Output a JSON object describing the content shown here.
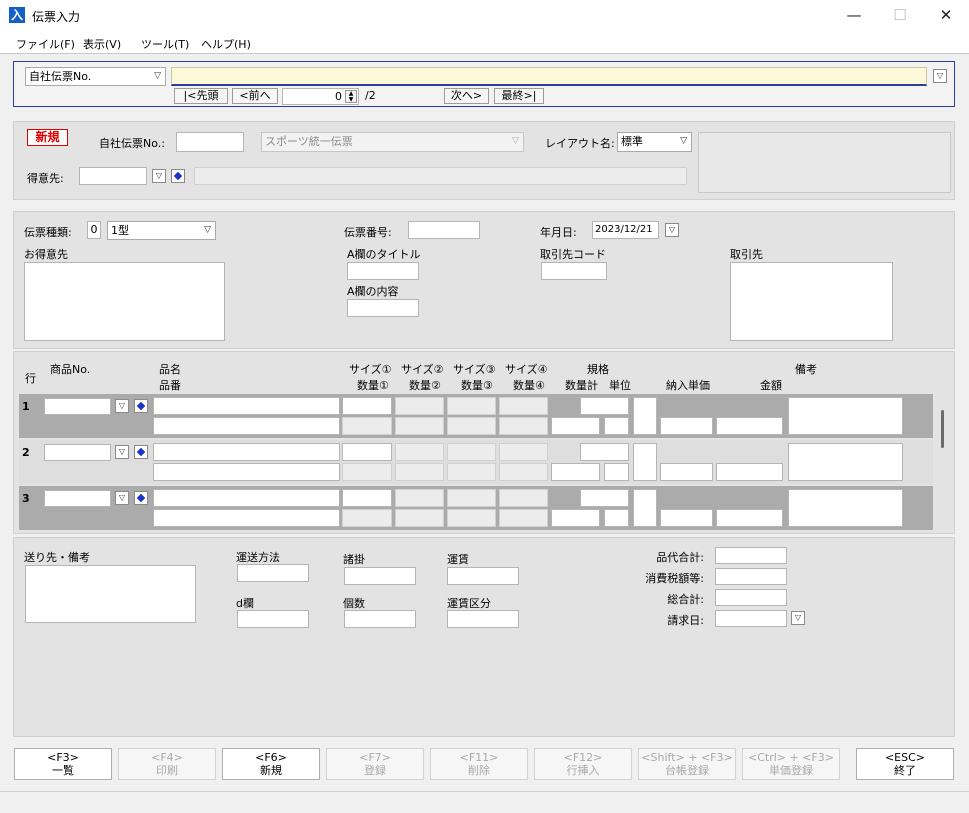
{
  "window": {
    "title": "伝票入力",
    "minimize": "—",
    "maximize": "☐",
    "close": "✕"
  },
  "menu": [
    {
      "label": "ファイル(F)"
    },
    {
      "label": "表示(V)"
    },
    {
      "label": "ツール(T)"
    },
    {
      "label": "ヘルプ(H)"
    }
  ],
  "search": {
    "type_select": "自社伝票No.",
    "first_btn": "|<先頭",
    "prev_btn": "<前へ",
    "page_value": "0",
    "page_total": "/2",
    "next_btn": "次へ>",
    "last_btn": "最終>|"
  },
  "header": {
    "new_badge": "新規",
    "slip_no_label": "自社伝票No.:",
    "slip_type_select": "スポーツ統一伝票",
    "layout_label": "レイアウト名:",
    "layout_value": "標準",
    "customer_label": "得意先:"
  },
  "slip": {
    "kind_label": "伝票種類:",
    "kind_code": "0",
    "kind_value": "1型",
    "number_label": "伝票番号:",
    "date_label": "年月日:",
    "date_value": "2023/12/21",
    "customer_box_label": "お得意先",
    "a_title_label": "A欄のタイトル",
    "a_content_label": "A欄の内容",
    "partner_code_label": "取引先コード",
    "partner_label": "取引先"
  },
  "grid": {
    "headers": {
      "row": "行",
      "product_no": "商品No.",
      "name": "品名",
      "code": "品番",
      "size1": "サイズ①",
      "size2": "サイズ②",
      "size3": "サイズ③",
      "size4": "サイズ④",
      "qty1": "数量①",
      "qty2": "数量②",
      "qty3": "数量③",
      "qty4": "数量④",
      "spec": "規格",
      "qty_total": "数量計",
      "unit": "単位",
      "unit_price": "納入単価",
      "amount": "金額",
      "remarks": "備考"
    },
    "rows": [
      {
        "no": "1"
      },
      {
        "no": "2"
      },
      {
        "no": "3"
      }
    ]
  },
  "footer": {
    "dest_label": "送り先・備考",
    "shipping_label": "運送方法",
    "misc_label": "諸掛",
    "freight_label": "運賃",
    "d_label": "d欄",
    "count_label": "個数",
    "freight_type_label": "運賃区分",
    "subtotal_label": "品代合計:",
    "tax_label": "消費税額等:",
    "total_label": "総合計:",
    "billing_date_label": "請求日:"
  },
  "fkeys": [
    {
      "key": "<F3>",
      "label": "一覧",
      "enabled": true
    },
    {
      "key": "<F4>",
      "label": "印刷",
      "enabled": false
    },
    {
      "key": "<F6>",
      "label": "新規",
      "enabled": true
    },
    {
      "key": "<F7>",
      "label": "登録",
      "enabled": false
    },
    {
      "key": "<F11>",
      "label": "削除",
      "enabled": false
    },
    {
      "key": "<F12>",
      "label": "行挿入",
      "enabled": false
    },
    {
      "key": "<Shift> + <F3>",
      "label": "台帳登録",
      "enabled": false
    },
    {
      "key": "<Ctrl> + <F3>",
      "label": "単価登録",
      "enabled": false
    },
    {
      "key": "<ESC>",
      "label": "終了",
      "enabled": true
    }
  ],
  "colors": {
    "accent": "#2a3ea0",
    "input_highlight": "#fdf8d8",
    "new_badge": "#e00000",
    "row_band": "#ababab"
  }
}
